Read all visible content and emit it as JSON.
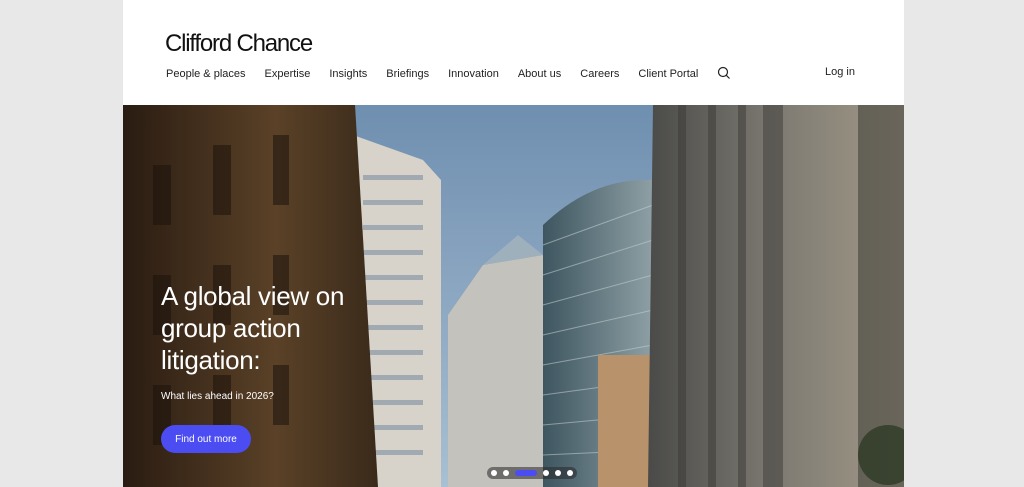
{
  "header": {
    "logo": "Clifford Chance",
    "nav": [
      "People & places",
      "Expertise",
      "Insights",
      "Briefings",
      "Innovation",
      "About us",
      "Careers",
      "Client Portal"
    ],
    "login": "Log in",
    "search_icon": "search-icon"
  },
  "hero": {
    "title": "A global view on group action litigation:",
    "subtitle": "What lies ahead in 2026?",
    "cta": "Find out more",
    "carousel": {
      "slides": 6,
      "active": 2
    }
  },
  "colors": {
    "accent": "#4b4cf2",
    "page_bg": "#e8e8e8"
  }
}
